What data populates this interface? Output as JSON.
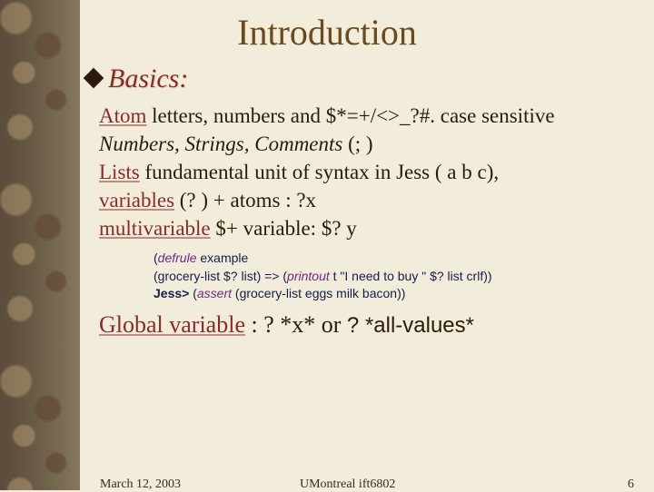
{
  "slide": {
    "title": "Introduction",
    "heading": "Basics:",
    "bullet_icon": "diamond-icon",
    "body": {
      "atom_term": "Atom",
      "atom_rest": " letters, numbers and $*=+/<>_?#.  case sensitive ",
      "atom_italic": "Numbers, Strings, Comments ",
      "atom_tail": "(; )",
      "lists_term": "Lists",
      "lists_rest": " fundamental unit of syntax in Jess ( a b c),",
      "vars_term": "variables",
      "vars_rest": " (? ) + atoms : ?x",
      "multi_term": "multivariable",
      "multi_rest": " $+ variable:  $? y",
      "global_term": "Global variable",
      "global_rest_a": " : ? *x* or ",
      "global_rest_b": "? *all-values*"
    },
    "code": {
      "l1a": "(",
      "l1kw": "defrule",
      "l1b": " example",
      "l2a": "(grocery-list $? list) => (",
      "l2kw": "printout",
      "l2b": " t \"I need to buy \" $? list crlf))",
      "l3a": "Jess> ",
      "l3b": "(",
      "l3kw": "assert",
      "l3c": " (grocery-list eggs milk bacon))"
    }
  },
  "footer": {
    "date": "March 12, 2003",
    "source": "UMontreal ift6802",
    "page": "6"
  }
}
